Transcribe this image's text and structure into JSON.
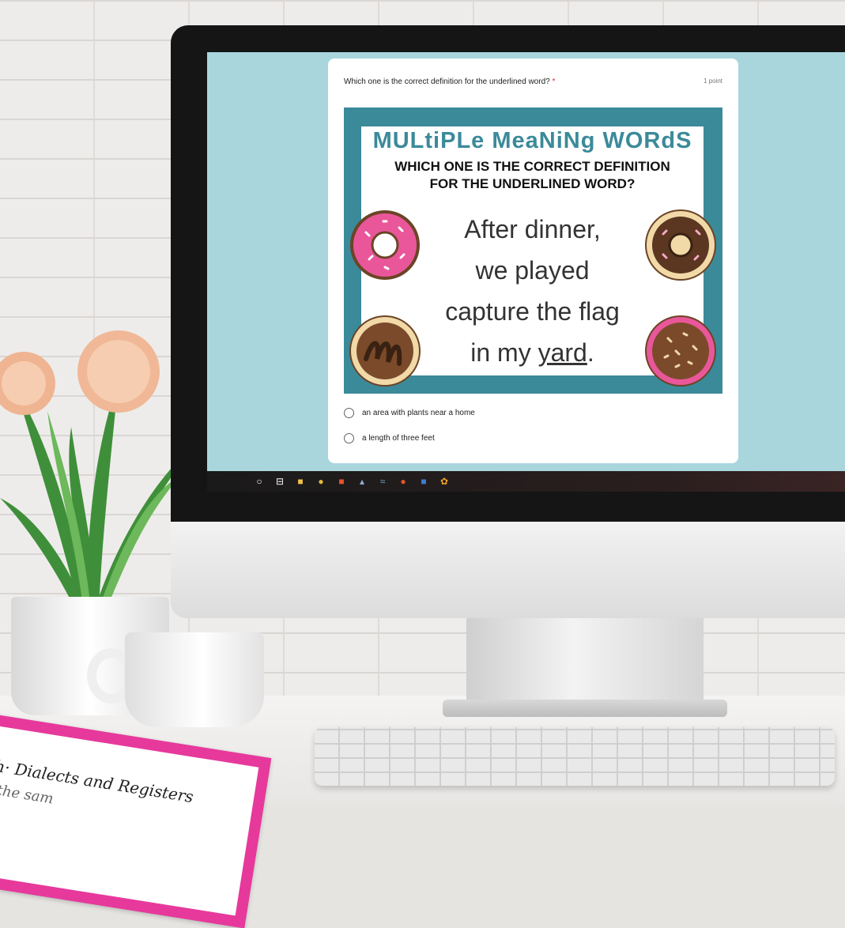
{
  "form": {
    "question": "Which one is the correct definition for the underlined word?",
    "required_marker": "*",
    "points": "1 point",
    "image": {
      "title": "MULtiPLe MeaNiNg WORdS",
      "subtitle_line1": "WHICH ONE IS THE CORRECT DEFINITION",
      "subtitle_line2": "FOR THE UNDERLINED WORD?",
      "sentence_line1": "After dinner,",
      "sentence_line2": "we played",
      "sentence_line3": "capture the flag",
      "sentence_line4_prefix": "in my ",
      "sentence_underlined": "yard",
      "sentence_suffix": "."
    },
    "options": [
      {
        "label": "an area with plants near a home"
      },
      {
        "label": "a length of three feet"
      }
    ]
  },
  "taskbar": {
    "icons": [
      "start-icon",
      "task-view-icon",
      "file-explorer-icon",
      "chrome-icon",
      "office-icon",
      "acrobat-icon",
      "app-icon",
      "powerpoint-icon",
      "mail-icon",
      "settings-icon"
    ]
  },
  "desk_card": {
    "line1": "h· Dialects and Registers",
    "line2": "n the sam"
  },
  "colors": {
    "screen_bg": "#a8d6dc",
    "accent_teal": "#3b8a9a",
    "required_red": "#d93025",
    "card_border_pink": "#e6399b"
  }
}
